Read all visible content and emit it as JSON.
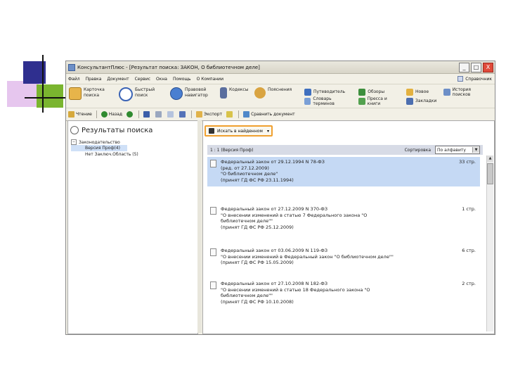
{
  "window": {
    "title": "КонсультантПлюс - [Результат поиска: ЗАКОН, О библиотечном деле]",
    "buttons": [
      "_",
      "□",
      "X"
    ]
  },
  "menu": {
    "items": [
      "Файл",
      "Правка",
      "Документ",
      "Сервис",
      "Окна",
      "Помощь",
      "О Компании"
    ],
    "right_label": "Справочник"
  },
  "toolbar": {
    "card_search": "Карточка поиска",
    "quick_search": "Быстрый поиск",
    "legal_navigator": "Правовой навигатор",
    "codes": "Кодексы",
    "consultations": "Пояснения",
    "press_review": "Путеводитель",
    "dictionary": "Словарь терминов",
    "reference": "Обзоры",
    "press": "Пресса и книги",
    "new": "Новое",
    "history": "История поисков",
    "bookmarks": "Закладки"
  },
  "toolbar2": {
    "print": "Чтение",
    "back": "Назад",
    "forward": "",
    "export": "Экспорт",
    "compare": "Сравнить документ"
  },
  "left_pane": {
    "title": "Результаты поиска",
    "tree_root": "Законодательство",
    "tree_items": [
      "Версия Проф(4)",
      "Нет Заключ.Область (5)"
    ]
  },
  "right_pane": {
    "folder_button": "Искать в найденном",
    "list_count": "1 : 1 (Версия Проф)",
    "sort_label": "Сортировка",
    "sort_value": "По алфавиту",
    "documents": [
      {
        "lines": [
          "Федеральный закон от 29.12.1994 N 78-ФЗ",
          "(ред. от 27.12.2009)",
          "\"О библиотечном деле\"",
          "(принят ГД ФС РФ 23.11.1994)"
        ],
        "pages": "33 стр."
      },
      {
        "lines": [
          "Федеральный закон от 27.12.2009 N 370-ФЗ",
          "\"О внесении изменений в статью 7 Федерального закона \"О",
          "библиотечном деле\"\"",
          "(принят ГД ФС РФ 25.12.2009)"
        ],
        "pages": "1 стр."
      },
      {
        "lines": [
          "Федеральный закон от 03.06.2009 N 119-ФЗ",
          "\"О внесении изменений в Федеральный закон \"О библиотечном деле\"\"",
          "(принят ГД ФС РФ 15.05.2009)"
        ],
        "pages": "6 стр."
      },
      {
        "lines": [
          "Федеральный закон от 27.10.2008 N 182-ФЗ",
          "\"О внесении изменений в статью 18 Федерального закона \"О",
          "библиотечном деле\"\"",
          "(принят ГД ФС РФ 10.10.2008)"
        ],
        "pages": "2 стр."
      }
    ]
  }
}
